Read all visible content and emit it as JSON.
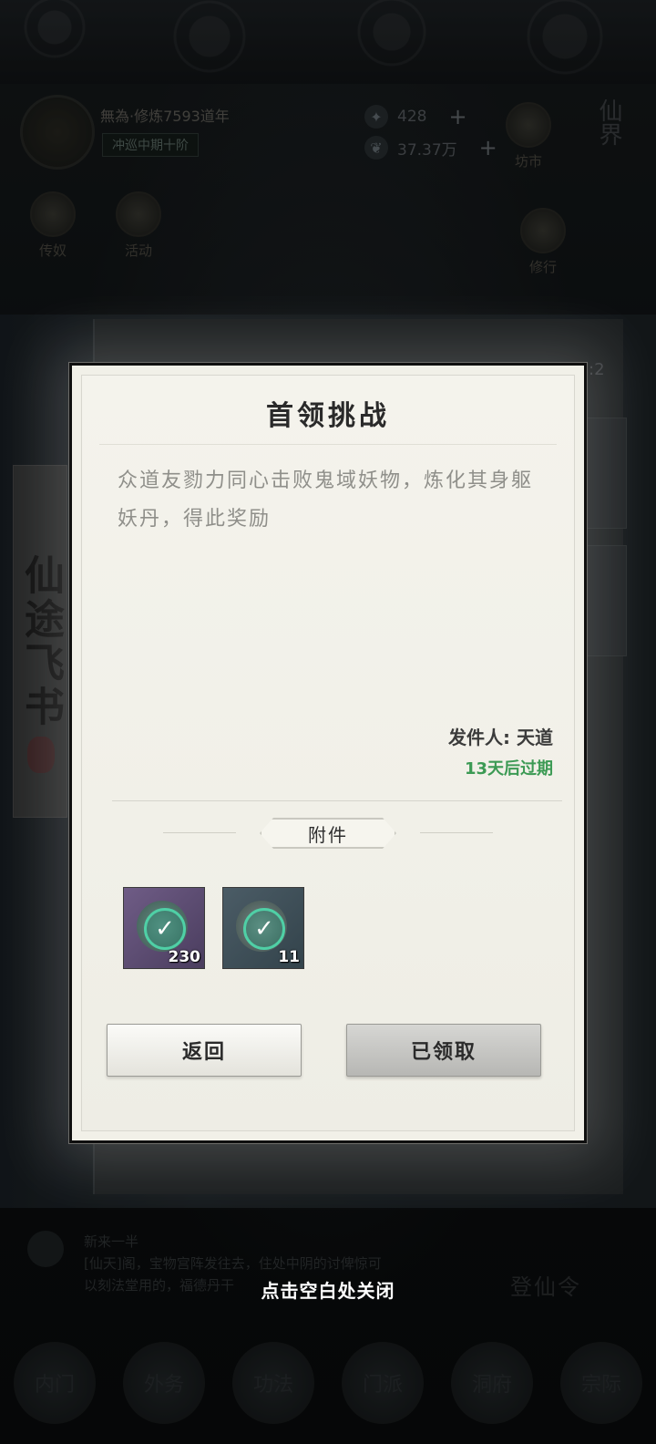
{
  "hud": {
    "player_name": "無為·修炼7593道年",
    "realm": "冲巡中期十阶",
    "res1_value": "428",
    "res2_value": "37.37万",
    "plus": "+",
    "market_label": "坊市",
    "vertical_label": "仙界",
    "left_icon1_label": "传奴",
    "left_icon2_label": "活动",
    "right_icon_label": "修行"
  },
  "background": {
    "scroll_title": "仙途飞书",
    "count": ":2",
    "bottom_line1": "新来一半",
    "bottom_line2": "[仙天]阁，宝物宫阵发往去，住处中阴的讨俾惊可",
    "bottom_line3": "以刻法堂用的，福德丹干",
    "login_label": "登仙令",
    "nav": [
      "内门",
      "外务",
      "功法",
      "门派",
      "洞府",
      "宗际"
    ]
  },
  "modal": {
    "title": "首领挑战",
    "body": "众道友勠力同心击败鬼域妖物，炼化其身躯妖丹，得此奖励",
    "sender": "发件人: 天道",
    "expire": "13天后过期",
    "attachment_label": "附件",
    "items": [
      {
        "icon": "dragon-spirit-icon",
        "count": "230",
        "claimed": true
      },
      {
        "icon": "scroll-icon",
        "count": "11",
        "claimed": true
      }
    ],
    "back_button": "返回",
    "claimed_button": "已领取",
    "colors": {
      "expire": "#3c9a54",
      "check": "#4fd0a6"
    }
  },
  "close_hint": "点击空白处关闭"
}
